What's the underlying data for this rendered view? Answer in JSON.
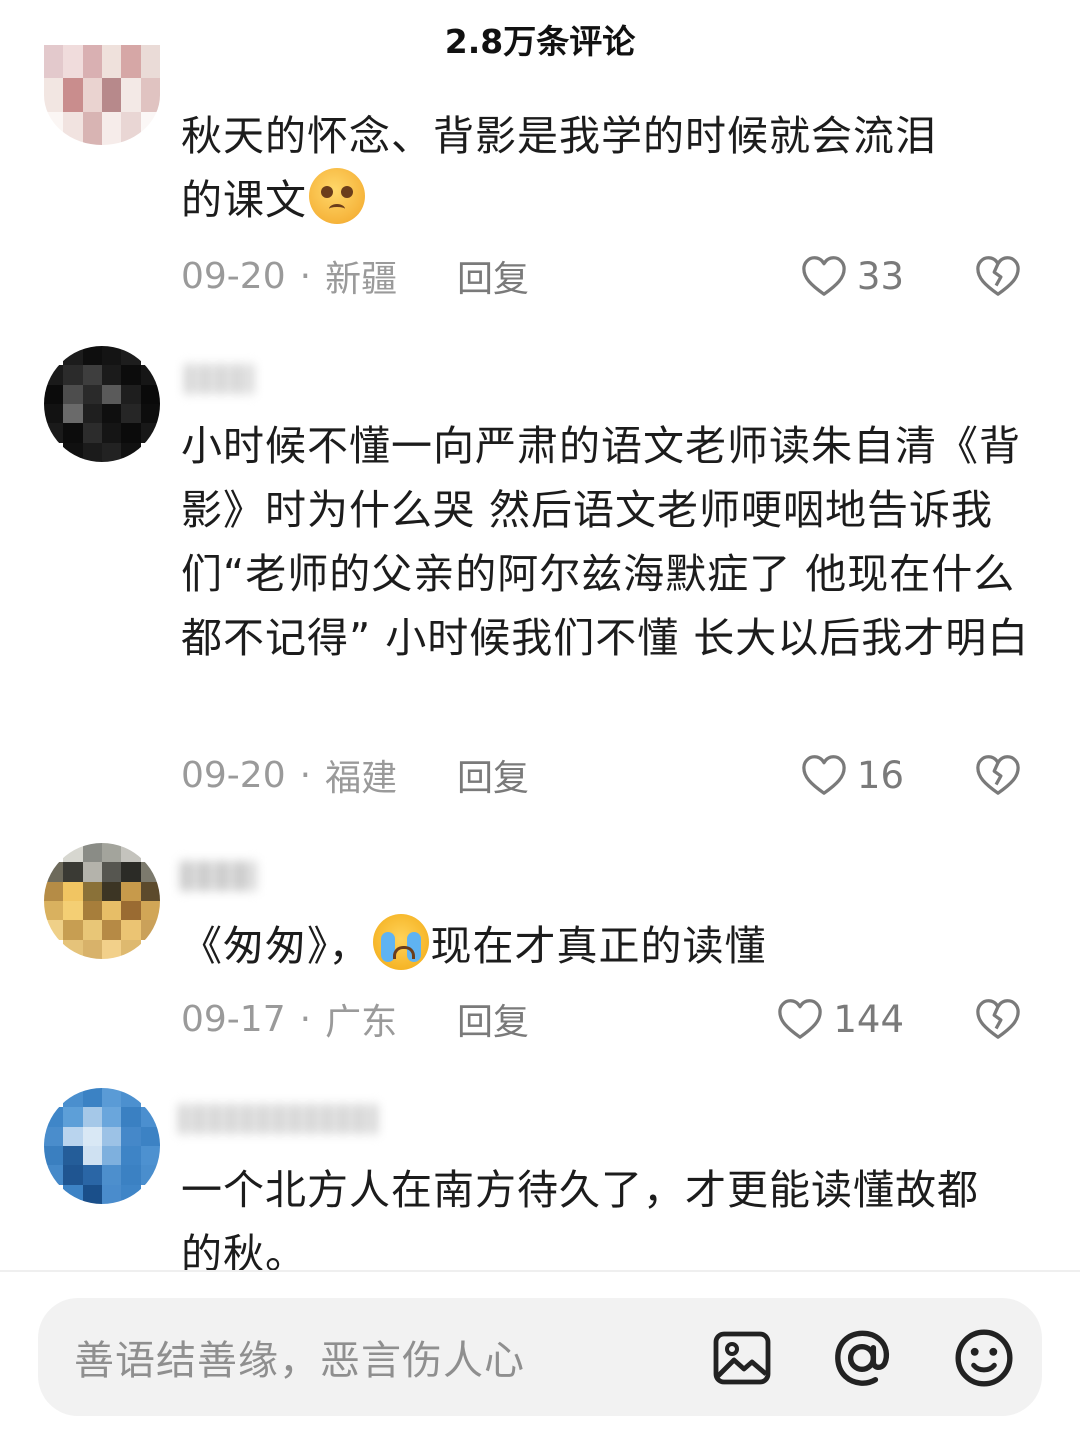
{
  "header": {
    "title": "2.8万条评论"
  },
  "comments": [
    {
      "text_parts": [
        "秋天的怀念、背影是我学的时候就会流泪",
        "的课文"
      ],
      "emoji": "pleading-face-icon",
      "date": "09-20",
      "location": "新疆",
      "reply_label": "回复",
      "likes": "33"
    },
    {
      "text": "小时候不懂一向严肃的语文老师读朱自清《背影》时为什么哭 然后语文老师哽咽地告诉我们“老师的父亲的阿尔兹海默症了 他现在什么都不记得” 小时候我们不懂 长大以后我才明白",
      "date": "09-20",
      "location": "福建",
      "reply_label": "回复",
      "likes": "16"
    },
    {
      "text_parts": [
        "《匆匆》，",
        "现在才真正的读懂"
      ],
      "emoji": "loudly-crying-face-icon",
      "date": "09-17",
      "location": "广东",
      "reply_label": "回复",
      "likes": "144"
    },
    {
      "text": "一个北方人在南方待久了，才更能读懂故都的秋。"
    }
  ],
  "meta_separator": "·",
  "input": {
    "placeholder": "善语结善缘，恶言伤人心"
  },
  "icons": {
    "like": "heart-outline-icon",
    "dislike": "broken-heart-icon",
    "image": "image-icon",
    "mention": "at-sign-icon",
    "emoji": "smiley-face-icon"
  }
}
